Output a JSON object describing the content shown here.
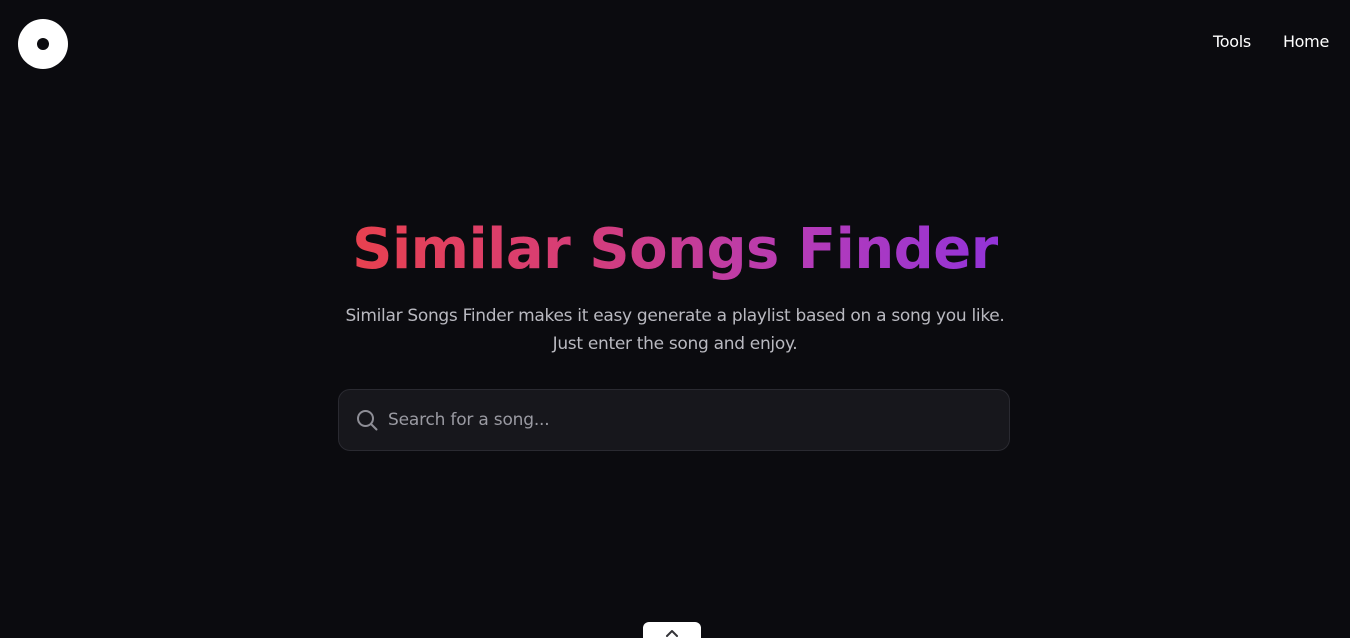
{
  "header": {
    "logo_icon": "vinyl-disc-icon",
    "nav": [
      {
        "label": "Tools"
      },
      {
        "label": "Home"
      }
    ]
  },
  "hero": {
    "title": "Similar Songs Finder",
    "title_gradient": [
      "#e8414f",
      "#d63d78",
      "#b53bb8",
      "#9333d8"
    ],
    "subtitle": "Similar Songs Finder makes it easy generate a playlist based on a song you like. Just enter the song and enjoy."
  },
  "search": {
    "icon": "search-icon",
    "placeholder": "Search for a song...",
    "value": ""
  },
  "scroll_button": {
    "icon": "chevron-up-icon"
  },
  "colors": {
    "background": "#0b0b0f",
    "search_background": "#17171c",
    "text_muted": "#b9b9c0"
  }
}
